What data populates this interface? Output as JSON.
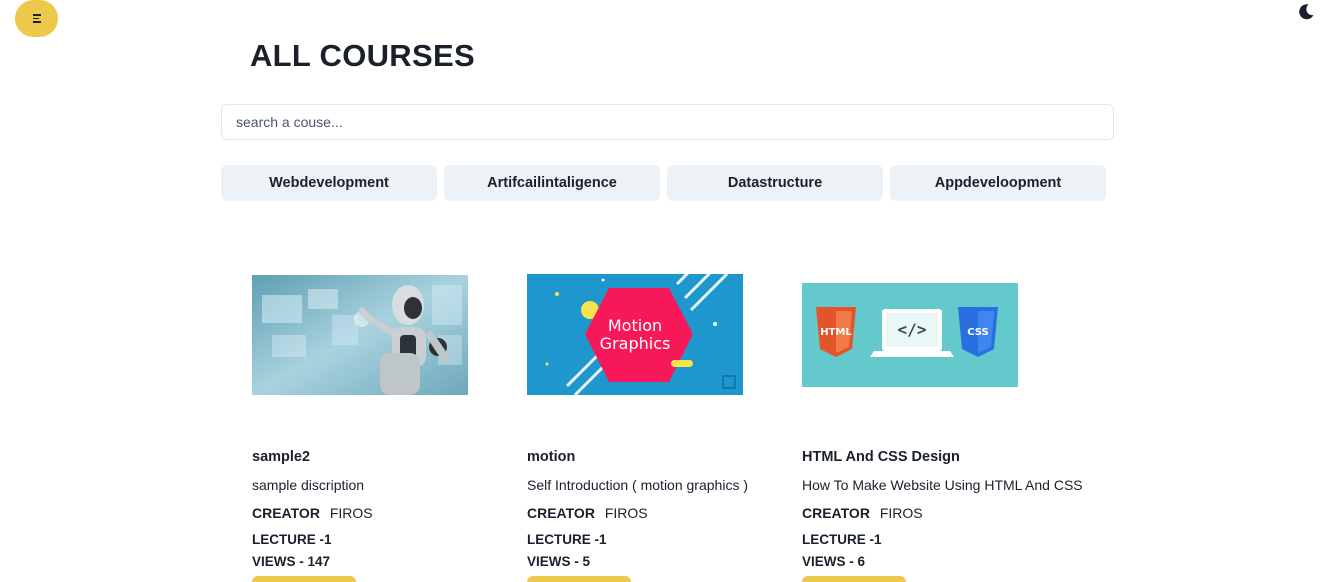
{
  "header": {
    "menu_icon": "hamburger-menu-icon",
    "theme_icon": "moon-icon",
    "title": "ALL COURSES"
  },
  "search": {
    "placeholder": "search a couse...",
    "value": ""
  },
  "categories": [
    {
      "label": "Webdevelopment"
    },
    {
      "label": "Artifcailintaligence"
    },
    {
      "label": "Datastructure"
    },
    {
      "label": "Appdeveloopment"
    }
  ],
  "courses": [
    {
      "title": "sample2",
      "description": "sample discription",
      "creator_label": "CREATOR",
      "creator": "FIROS",
      "lecture_label": "LECTURE",
      "lectures": "-1",
      "views_label": "VIEWS -",
      "views": "147",
      "thumbnail": "robot-ai-image"
    },
    {
      "title": "motion",
      "description": "Self Introduction ( motion graphics )",
      "creator_label": "CREATOR",
      "creator": "FIROS",
      "lecture_label": "LECTURE",
      "lectures": "-1",
      "views_label": "VIEWS -",
      "views": "5",
      "thumbnail": "motion-graphics-image",
      "thumbnail_text": [
        "Motion",
        "Graphics"
      ]
    },
    {
      "title": "HTML And CSS Design",
      "description": "How To Make Website Using HTML And CSS",
      "creator_label": "CREATOR",
      "creator": "FIROS",
      "lecture_label": "LECTURE",
      "lectures": "-1",
      "views_label": "VIEWS -",
      "views": "6",
      "thumbnail": "html-css-image",
      "thumbnail_text": [
        "HTML",
        "</>",
        "CSS"
      ]
    }
  ],
  "colors": {
    "accent": "#ecc94b",
    "category_bg": "#edf2f7",
    "text": "#1a202c"
  }
}
